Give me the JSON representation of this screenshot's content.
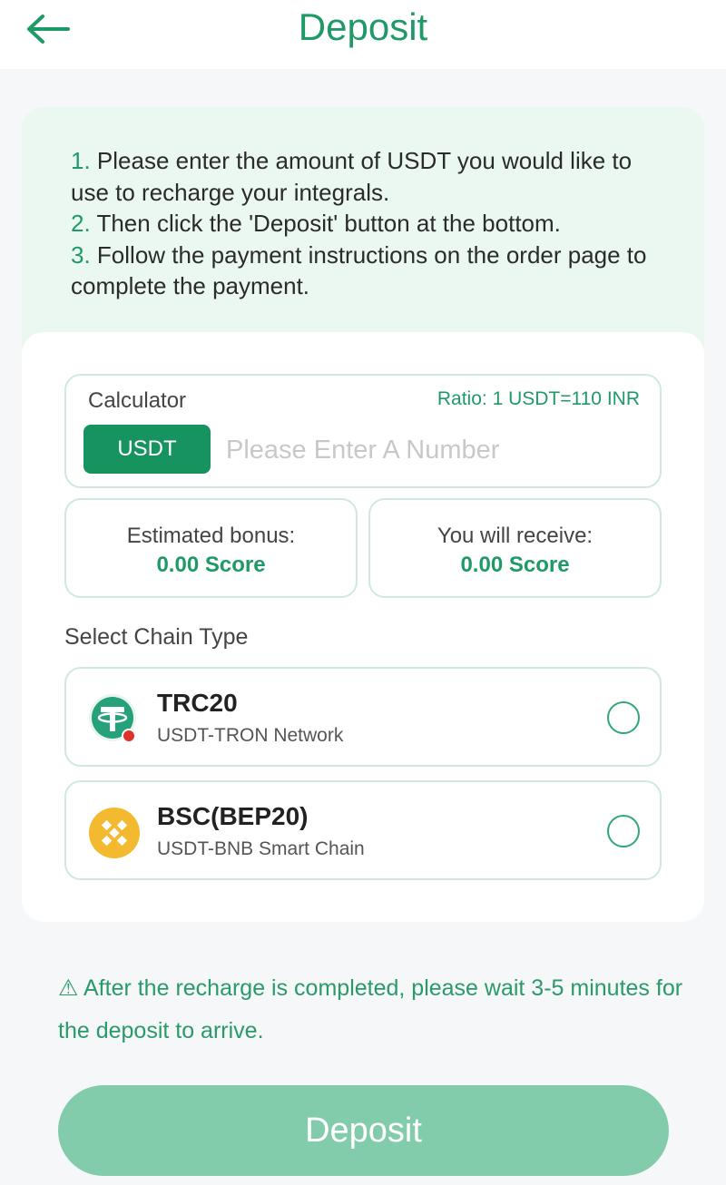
{
  "header": {
    "title": "Deposit",
    "back_icon": "arrow-left-icon"
  },
  "instructions": [
    {
      "num": "1.",
      "text": "Please enter the amount of USDT you would like to use to recharge your integrals."
    },
    {
      "num": "2.",
      "text": "Then click the 'Deposit' button at the bottom."
    },
    {
      "num": "3.",
      "text": "Follow the payment instructions on the order page to complete the payment."
    }
  ],
  "calculator": {
    "label": "Calculator",
    "ratio": "Ratio: 1 USDT=110 INR",
    "currency_button": "USDT",
    "input_value": "",
    "input_placeholder": "Please Enter A Number"
  },
  "stats": {
    "bonus_label": "Estimated bonus:",
    "bonus_value": "0.00 Score",
    "receive_label": "You will receive:",
    "receive_value": "0.00 Score"
  },
  "chains": {
    "title": "Select Chain Type",
    "options": [
      {
        "name": "TRC20",
        "sub": "USDT-TRON Network",
        "icon": "tether-icon",
        "selected": false
      },
      {
        "name": "BSC(BEP20)",
        "sub": "USDT-BNB Smart Chain",
        "icon": "bnb-icon",
        "selected": false
      }
    ]
  },
  "notice": {
    "icon": "warning-icon",
    "symbol": "⚠",
    "text": "After the recharge is completed, please wait 3-5 minutes for the deposit to arrive."
  },
  "deposit_button": "Deposit",
  "colors": {
    "accent": "#1f9a67",
    "button_disabled": "#83ccab",
    "info_bg": "#eaf8f1",
    "border": "#cfe9dd",
    "tether": "#26a17b",
    "bnb": "#f3ba2f",
    "tron": "#e0312c"
  }
}
